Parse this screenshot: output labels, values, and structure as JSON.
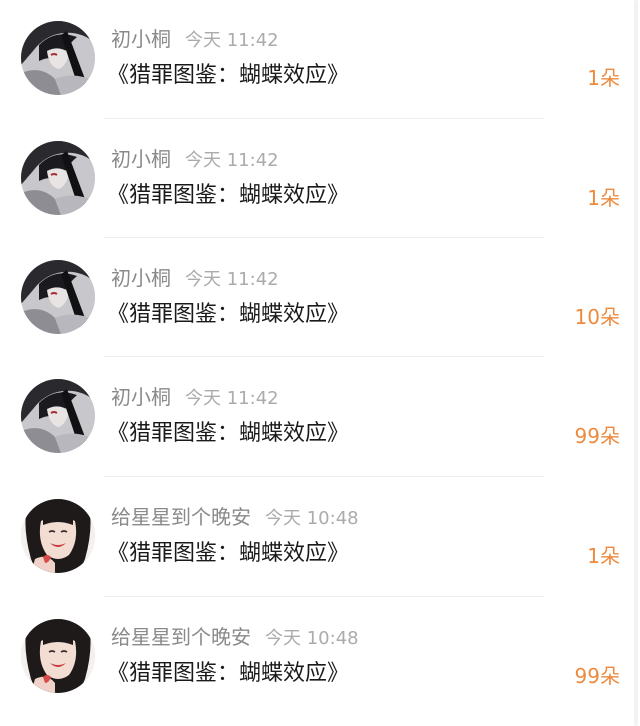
{
  "comments": [
    {
      "user": "初小桐",
      "time": "今天 11:42",
      "title": "《猎罪图鉴：蝴蝶效应》",
      "count": "1朵",
      "avatar": "dark-haired-anime-avatar"
    },
    {
      "user": "初小桐",
      "time": "今天 11:42",
      "title": "《猎罪图鉴：蝴蝶效应》",
      "count": "1朵",
      "avatar": "dark-haired-anime-avatar"
    },
    {
      "user": "初小桐",
      "time": "今天 11:42",
      "title": "《猎罪图鉴：蝴蝶效应》",
      "count": "10朵",
      "avatar": "dark-haired-anime-avatar"
    },
    {
      "user": "初小桐",
      "time": "今天 11:42",
      "title": "《猎罪图鉴：蝴蝶效应》",
      "count": "99朵",
      "avatar": "dark-haired-anime-avatar"
    },
    {
      "user": "给星星到个晚安",
      "time": "今天 10:48",
      "title": "《猎罪图鉴：蝴蝶效应》",
      "count": "1朵",
      "avatar": "smiling-girl-photo-avatar"
    },
    {
      "user": "给星星到个晚安",
      "time": "今天 10:48",
      "title": "《猎罪图鉴：蝴蝶效应》",
      "count": "99朵",
      "avatar": "smiling-girl-photo-avatar"
    }
  ],
  "colors": {
    "name": "#8a8a8a",
    "time": "#ababab",
    "title": "#1a1a1a",
    "count": "#ee8a3e",
    "divider": "#efefef"
  }
}
